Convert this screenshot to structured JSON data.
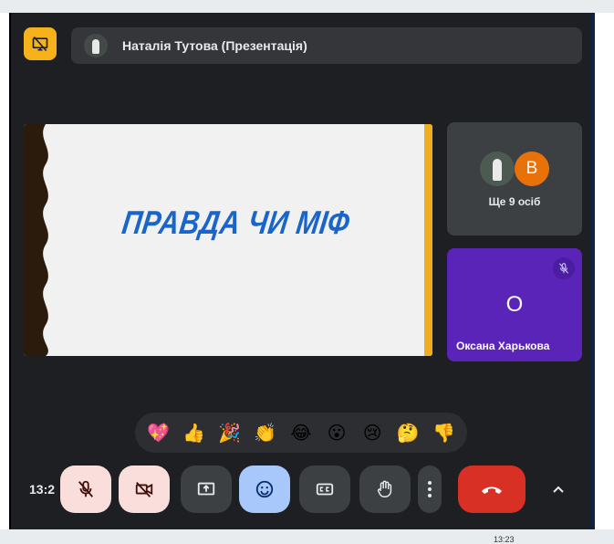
{
  "presenter": {
    "name": "Наталія Тутова (Презентація)"
  },
  "slide": {
    "title": "ПРАВДА ЧИ МІФ"
  },
  "participants": {
    "more_initial": "В",
    "more_label": "Ще 9 осіб",
    "person_initial": "О",
    "person_name": "Оксана Харькова"
  },
  "reactions": [
    "💖",
    "👍",
    "🎉",
    "👏",
    "😂",
    "😮",
    "😢",
    "🤔",
    "👎"
  ],
  "controls": {
    "clock": "13:2"
  },
  "taskbar": {
    "time": "13:23"
  },
  "colors": {
    "background": "#1e1f22",
    "tile": "#3c4043",
    "accent_yellow": "#f6b21b",
    "person_tile": "#5b24b9",
    "slide_title": "#1a65c9",
    "end_call": "#d93025",
    "active_button": "#a8c7fa",
    "muted_button": "#f9dedc"
  }
}
